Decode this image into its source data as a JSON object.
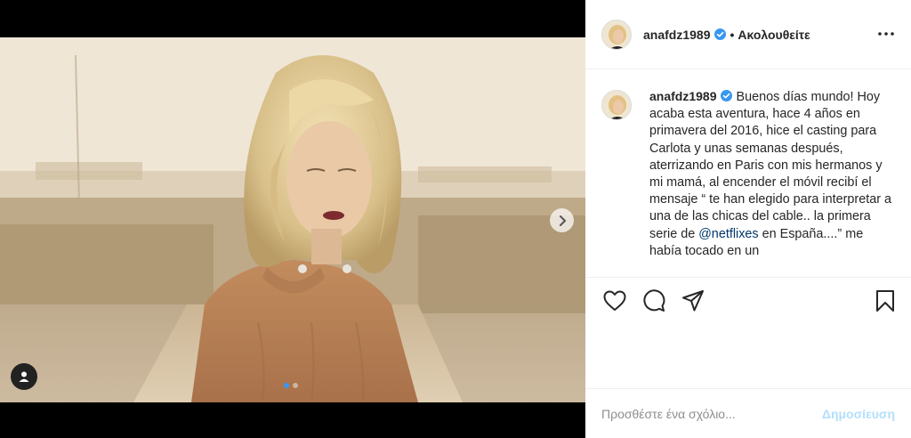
{
  "post": {
    "image_alt": "",
    "carousel": {
      "slides": 2,
      "active_index": 0
    }
  },
  "header": {
    "username": "anafdz1989",
    "separator": "•",
    "follow_label": "Ακολουθείτε",
    "verified_icon": "verified-badge-icon",
    "more_icon": "more-options-icon"
  },
  "caption": {
    "username": "anafdz1989",
    "text_before_mention": "Buenos días mundo! Hoy acaba esta aventura, hace 4 años en primavera del 2016, hice el casting para Carlota y unas semanas después, aterrizando en Paris con mis hermanos y mi mamá, al encender el móvil recibí el mensaje “ te han elegido para interpretar a una de las chicas del cable.. la primera serie de ",
    "mention": "@netflixes",
    "text_after_mention": " en España....” me había tocado en un"
  },
  "actions": {
    "like_icon": "heart-icon",
    "comment_icon": "comment-icon",
    "share_icon": "share-icon",
    "save_icon": "bookmark-icon"
  },
  "comment": {
    "placeholder": "Προσθέστε ένα σχόλιο...",
    "post_label": "Δημοσίευση"
  },
  "colors": {
    "accent": "#0095f6",
    "verified": "#3897f0",
    "post_disabled": "#b2dffc",
    "mention": "#00376b"
  }
}
